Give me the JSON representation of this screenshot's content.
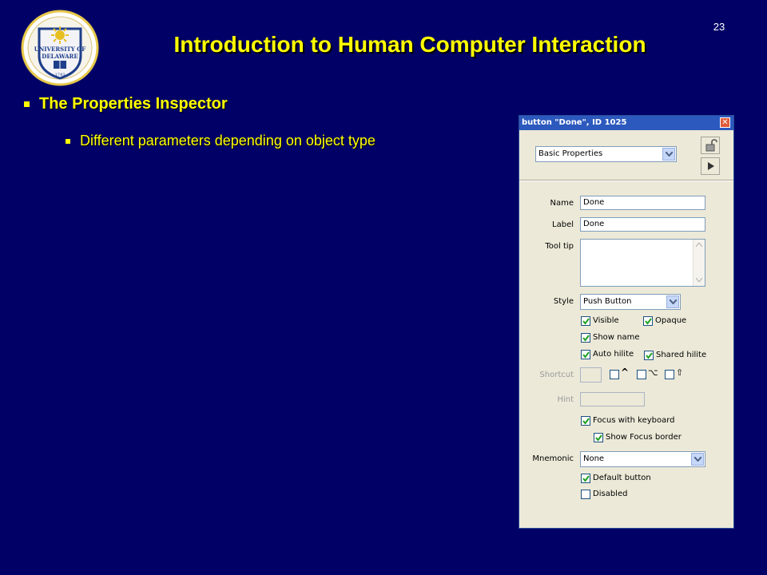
{
  "slide": {
    "title": "Introduction to Human Computer Interaction",
    "page_number": "23",
    "logo": {
      "name": "University of Delaware seal",
      "text_line1": "UNIVERSITY OF",
      "text_line2": "DELAWARE",
      "year": "1743",
      "colors": {
        "blue": "#1d3e8a",
        "gold": "#e7c022"
      }
    },
    "bullets": [
      {
        "text": "The Properties Inspector"
      },
      {
        "text": "Different parameters depending on object type"
      }
    ],
    "colors": {
      "background": "#000066",
      "title": "#FFFF00"
    }
  },
  "inspector": {
    "title": "button \"Done\", ID 1025",
    "view_select": "Basic Properties",
    "lock_icon": "unlock-icon",
    "next_icon": "play-arrow-icon",
    "fields": {
      "name_label": "Name",
      "name_value": "Done",
      "label_label": "Label",
      "label_value": "Done",
      "tooltip_label": "Tool tip",
      "tooltip_value": "",
      "style_label": "Style",
      "style_value": "Push Button",
      "shortcut_label": "Shortcut",
      "hint_label": "Hint",
      "mnemonic_label": "Mnemonic",
      "mnemonic_value": "None"
    },
    "checkboxes": {
      "visible": {
        "label": "Visible",
        "checked": true
      },
      "opaque": {
        "label": "Opaque",
        "checked": true
      },
      "show_name": {
        "label": "Show name",
        "checked": true
      },
      "auto_hilite": {
        "label": "Auto hilite",
        "checked": true
      },
      "shared_hilite": {
        "label": "Shared hilite",
        "checked": true
      },
      "focus_keyboard": {
        "label": "Focus with keyboard",
        "checked": true
      },
      "show_focus_border": {
        "label": "Show Focus border",
        "checked": true
      },
      "default_button": {
        "label": "Default button",
        "checked": true
      },
      "disabled": {
        "label": "Disabled",
        "checked": false
      }
    },
    "modifier_keys": {
      "control": "^",
      "option": "⌥",
      "shift": "⇧"
    }
  }
}
